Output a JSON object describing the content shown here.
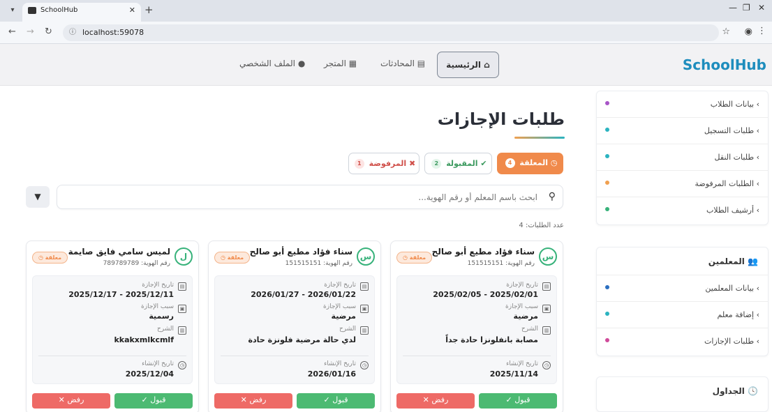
{
  "browser": {
    "tab_title": "SchoolHub",
    "url": "localhost:59078"
  },
  "header": {
    "brand": "SchoolHub",
    "nav": [
      {
        "label": "الرئيسية"
      },
      {
        "label": "المحادثات"
      },
      {
        "label": "المتجر"
      },
      {
        "label": "الملف الشخصي"
      }
    ]
  },
  "sidebar": {
    "students_items": [
      {
        "label": "بيانات الطلاب",
        "color": "#a855c7"
      },
      {
        "label": "طلبات التسجيل",
        "color": "#2bb3c0"
      },
      {
        "label": "طلبات النقل",
        "color": "#2bb3c0"
      },
      {
        "label": "الطلبات المرفوضة",
        "color": "#f0a050"
      },
      {
        "label": "أرشيف الطلاب",
        "color": "#37b27a"
      }
    ],
    "teachers_title": "المعلمين",
    "teachers_items": [
      {
        "label": "بيانات المعلمين",
        "color": "#2b6fc0"
      },
      {
        "label": "إضافة معلم",
        "color": "#2bb3c0"
      },
      {
        "label": "طلبات الإجازات",
        "color": "#d04a9a"
      }
    ],
    "schedules_title": "الجداول"
  },
  "main": {
    "title": "طلبات الإجازات",
    "tabs": {
      "pending": {
        "label": "المعلقة",
        "count": "4"
      },
      "accepted": {
        "label": "المقبولة",
        "count": "2"
      },
      "rejected": {
        "label": "المرفوضة",
        "count": "1"
      }
    },
    "search_placeholder": "ابحث باسم المعلم أو رقم الهوية...",
    "count_text": "عدد الطلبات: 4",
    "labels": {
      "leave_date": "تاريخ الإجازة",
      "leave_reason": "سبب الإجازة",
      "explanation": "الشرح",
      "created_date": "تاريخ الإنشاء",
      "id_prefix": "رقم الهوية:",
      "status": "معلقة",
      "accept": "✓ قبول",
      "reject": "✕ رفض"
    },
    "cards": [
      {
        "initial": "س",
        "name": "سناء فؤاد مطيع أبو صالح",
        "id": "151515151",
        "leave_date": "2025/02/05 - 2025/02/01",
        "reason": "مرضية",
        "explanation": "مصابة بانفلونزا حادة جداً",
        "created": "2025/11/14"
      },
      {
        "initial": "س",
        "name": "سناء فؤاد مطيع أبو صالح",
        "id": "151515151",
        "leave_date": "2026/01/27 - 2026/01/22",
        "reason": "مرضية",
        "explanation": "لدي حالة مرضية فلونزة حادة",
        "created": "2026/01/16"
      },
      {
        "initial": "ل",
        "name": "لميس سامي فايق صايمة",
        "id": "789789789",
        "leave_date": "2025/12/17 - 2025/12/11",
        "reason": "رسمية",
        "explanation": "kkakxmlkcmlf",
        "created": "2025/12/04"
      }
    ]
  }
}
